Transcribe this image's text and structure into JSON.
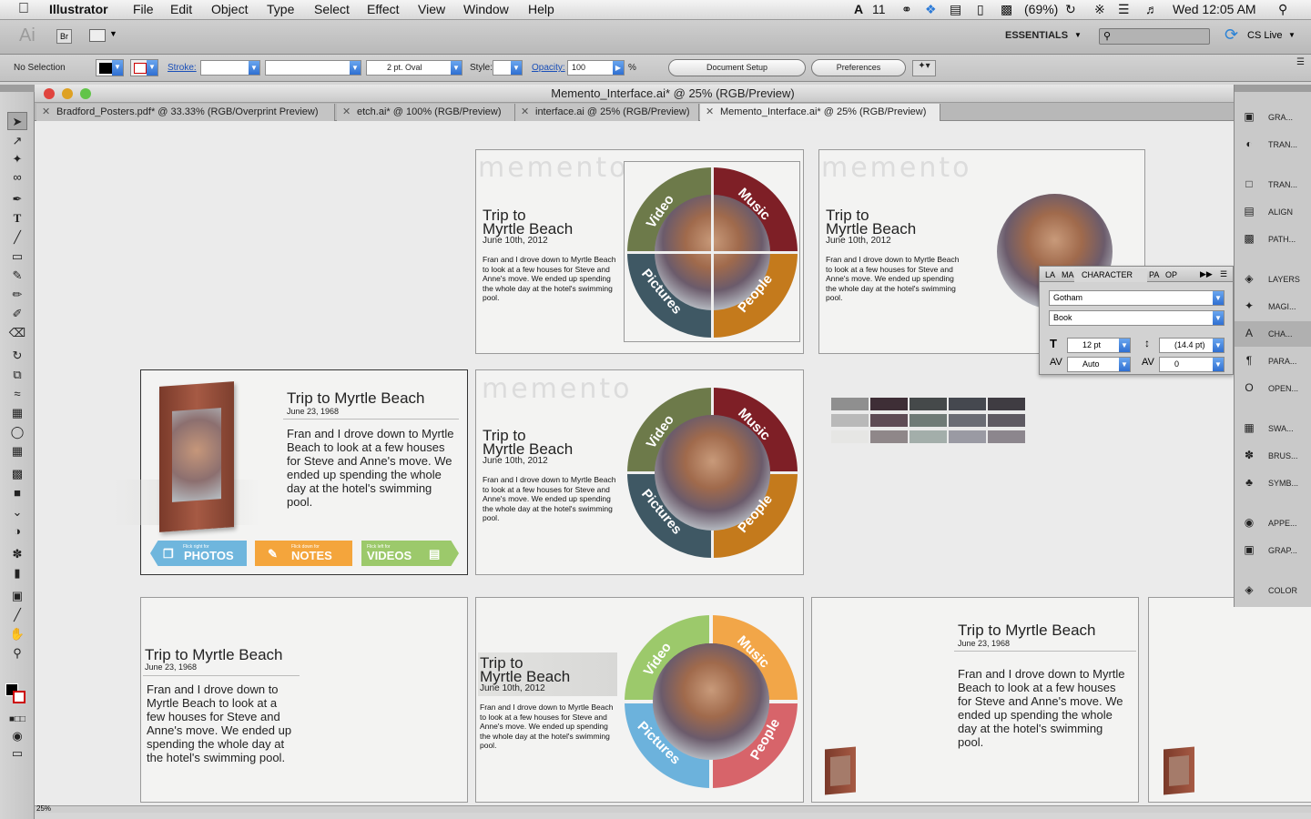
{
  "menubar": {
    "app_name": "Illustrator",
    "menus": [
      "File",
      "Edit",
      "Object",
      "Type",
      "Select",
      "Effect",
      "View",
      "Window",
      "Help"
    ],
    "status": {
      "adobe_badge": "11",
      "battery": "(69%)",
      "clock": "Wed 12:05 AM"
    }
  },
  "appbar": {
    "logo": "Ai",
    "bridge": "Br",
    "workspace": "ESSENTIALS",
    "search_placeholder": "",
    "cs_live": "CS Live"
  },
  "control": {
    "selection": "No Selection",
    "stroke_label": "Stroke:",
    "brush": "2 pt. Oval",
    "style_label": "Style:",
    "opacity_label": "Opacity:",
    "opacity_value": "100",
    "opacity_unit": "%",
    "doc_setup": "Document Setup",
    "preferences": "Preferences"
  },
  "window": {
    "title": "Memento_Interface.ai* @ 25% (RGB/Preview)",
    "tabs": [
      "Bradford_Posters.pdf* @ 33.33% (RGB/Overprint Preview)",
      "etch.ai* @ 100% (RGB/Preview)",
      "interface.ai @ 25% (RGB/Preview)",
      "Memento_Interface.ai* @ 25% (RGB/Preview)"
    ]
  },
  "content": {
    "memento": "memento",
    "trip_two_line_1": "Trip to",
    "trip_two_line_2": "Myrtle Beach",
    "trip_one_line": "Trip to Myrtle Beach",
    "date_2012": "June 10th, 2012",
    "date_1968": "June 23, 1968",
    "body_small": "Fran and I drove down to Myrtle Beach to look at a few houses for Steve and Anne's move. We ended up spending the whole day at the hotel's swimming pool.",
    "body_large": "Fran and I drove down to Myrtle Beach to look at a few houses for Steve and Anne's move. We ended up spending the whole day at the hotel's swimming pool.",
    "ring": {
      "video": "Video",
      "music": "Music",
      "pictures": "Pictures",
      "people": "People"
    },
    "chips": [
      {
        "hint": "Flick right for",
        "label": "PHOTOS",
        "color": "#6fb6dd"
      },
      {
        "hint": "Flick down for",
        "label": "NOTES",
        "color": "#f4a53c"
      },
      {
        "hint": "Flick left for",
        "label": "VIDEOS",
        "color": "#9cc96b"
      }
    ],
    "ring_colors": {
      "olive": "#6d7a4a",
      "maroon": "#7e1f26",
      "orange": "#c47a1c",
      "slate": "#3f5864"
    },
    "ring_colors_bright": {
      "green": "#9cc96b",
      "orange": "#f2a648",
      "blue": "#6cb2dc",
      "red": "#d7646a"
    }
  },
  "char_panel": {
    "tabs": [
      "LA",
      "MA",
      "CHARACTER",
      "PA",
      "OP"
    ],
    "font": "Gotham",
    "style": "Book",
    "size": "12 pt",
    "leading": "(14.4 pt)",
    "kerning": "Auto",
    "tracking": "0"
  },
  "right_panel": {
    "items": [
      "GRA...",
      "TRAN...",
      "TRAN...",
      "ALIGN",
      "PATH...",
      "LAYERS",
      "MAGI...",
      "CHA...",
      "PARA...",
      "OPEN...",
      "SWA...",
      "BRUS...",
      "SYMB...",
      "APPE...",
      "GRAP...",
      "COLOR"
    ]
  },
  "swatches": {
    "row1": [
      "#8f8f8f",
      "#3e2e36",
      "#45494a",
      "#45484f",
      "#3f3c42"
    ],
    "row2": [
      "#b9b9b9",
      "#5e4c55",
      "#6f7a76",
      "#6a6c74",
      "#5e5a62"
    ],
    "row3": [
      "#e6e6e4",
      "#8f8789",
      "#a3aeaa",
      "#9a9aa3",
      "#8c868d"
    ]
  },
  "statusbar": {
    "zoom": "25%"
  }
}
